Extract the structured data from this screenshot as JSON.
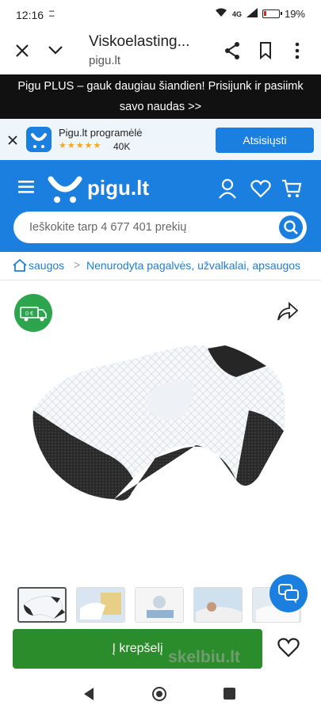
{
  "status_bar": {
    "time": "12:16",
    "battery": "19%",
    "network": "4G",
    "battery_level": 0.19
  },
  "browser": {
    "page_title": "Viskoelasting...",
    "url": "pigu.lt"
  },
  "promo": {
    "line1": "Pigu PLUS – gauk daugiau šiandien! Prisijunk ir pasiimk",
    "line2": "savo naudas >>"
  },
  "app_banner": {
    "name": "Pigu.lt programėlė",
    "rating_stars": "★★★★★",
    "reviews": "40K",
    "download_label": "Atsisiųsti"
  },
  "header": {
    "logo": "pigu.lt",
    "search_placeholder": "Ieškokite tarp 4 677 401 prekių"
  },
  "breadcrumbs": {
    "items": [
      "saugos",
      "Nenurodyta pagalvės, užvalkalai, apsaugos"
    ]
  },
  "product": {
    "delivery_badge": "0 €",
    "thumbnails": [
      "pillow-1",
      "pillow-2",
      "pillow-3",
      "pillow-4",
      "pillow-5"
    ]
  },
  "actions": {
    "add_to_cart": "Į krepšelį"
  },
  "watermark": "skelbiu.lt",
  "colors": {
    "brand_blue": "#1b7fe0",
    "cart_green": "#2a8c2a",
    "delivery_green": "#2da44e",
    "promo_bg": "#111111"
  }
}
